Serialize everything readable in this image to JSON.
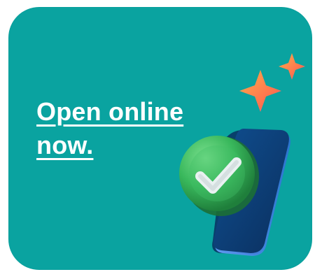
{
  "promo": {
    "cta_text": "Open online now."
  },
  "colors": {
    "card_background": "#0aa3a0",
    "text": "#ffffff",
    "phone_body": "#0e3a6f",
    "phone_edge": "#4a84df",
    "check_badge": "#37b65a",
    "sparkle": "#f39a3b"
  },
  "icons": {
    "phone": "smartphone-icon",
    "check": "check-badge-icon",
    "sparkles": "sparkles-icon"
  }
}
